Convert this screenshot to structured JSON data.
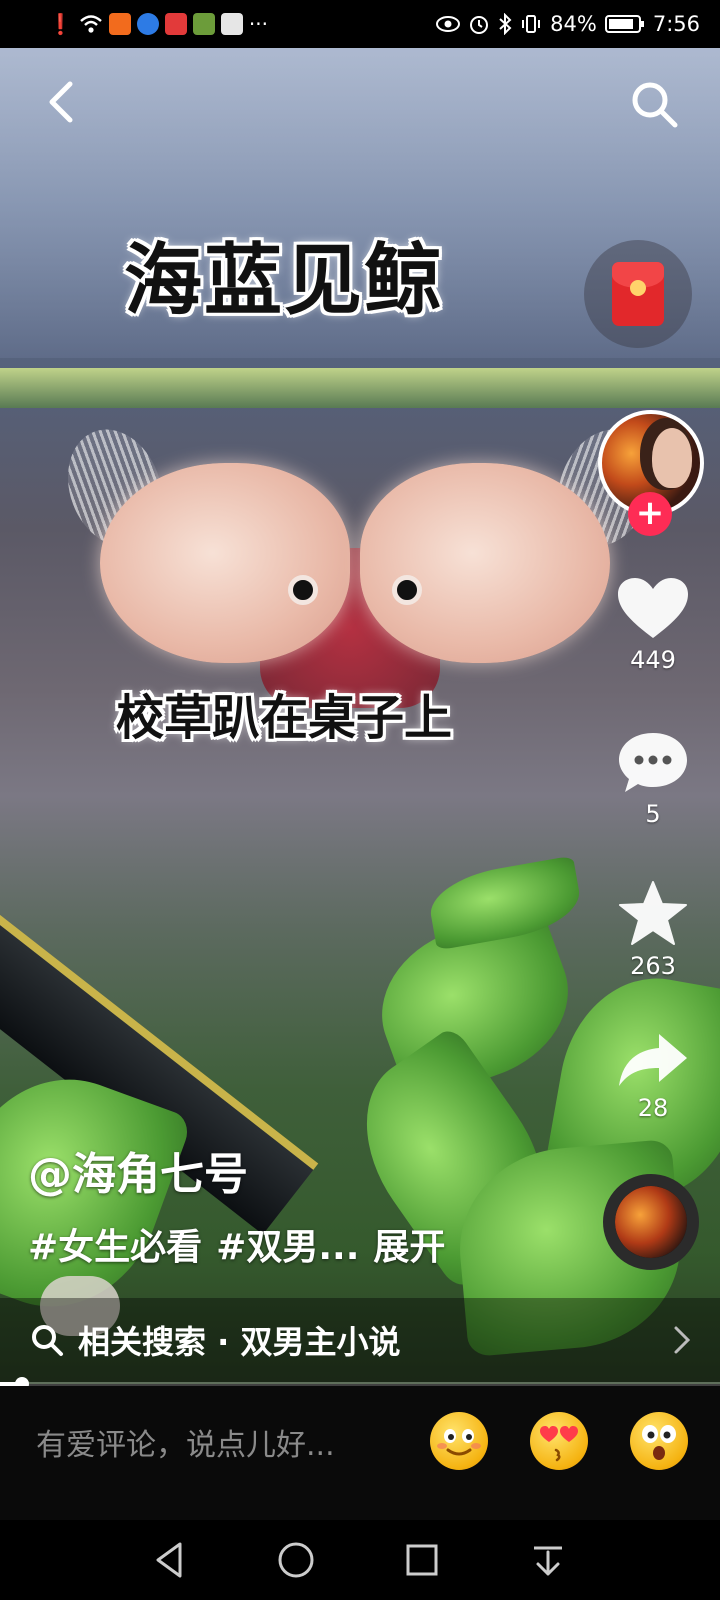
{
  "status_bar": {
    "battery": "84%",
    "time": "7:56",
    "more": "···"
  },
  "video": {
    "caption_title": "海蓝见鲸",
    "caption_subtitle": "校草趴在桌子上"
  },
  "actions": {
    "likes": "449",
    "comments": "5",
    "favorites": "263",
    "shares": "28"
  },
  "post": {
    "author": "@海角七号",
    "tags": [
      "#女生必看",
      "#双男..."
    ],
    "expand": "展开"
  },
  "related_search": {
    "label": "相关搜索 · 双男主小说"
  },
  "progress": {
    "fraction": 0.03
  },
  "comment_bar": {
    "placeholder": "有爱评论，说点儿好...",
    "emojis": [
      "smiling-face",
      "heart-eyes-kiss-face",
      "surprised-face"
    ]
  },
  "colors": {
    "accent_red": "#fe2c55",
    "background": "#000000",
    "comment_placeholder": "#8a8a8a"
  }
}
